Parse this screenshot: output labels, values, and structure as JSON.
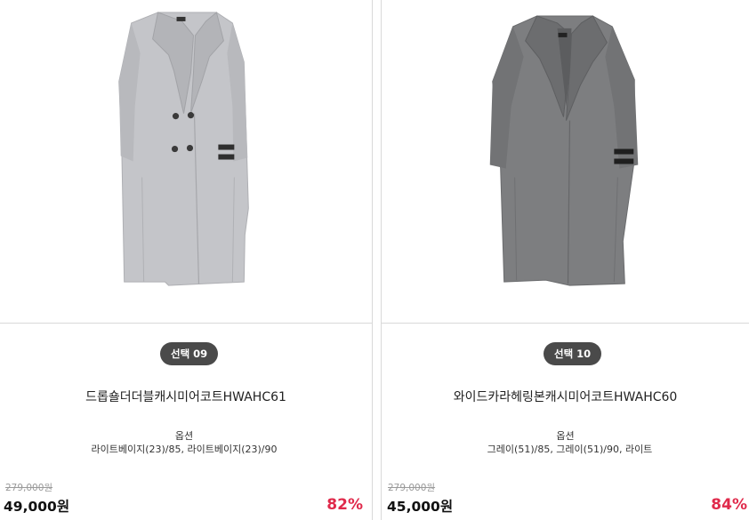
{
  "colors": {
    "badge_bg": "#4a4a4a",
    "discount": "#e02a4b",
    "original_price": "#9a9a9a",
    "divider": "#d9d9d9",
    "coat_light": "#c4c5c9",
    "coat_dark": "#7d7e80"
  },
  "products": [
    {
      "badge": "선택 09",
      "name": "드롭숄더더블캐시미어코트HWAHC61",
      "option_label": "옵션",
      "option_values": "라이트베이지(23)/85, 라이트베이지(23)/90",
      "original_price": "279,000원",
      "price": "49,000원",
      "discount": "82%",
      "image_alt": "light grey double-breasted long coat"
    },
    {
      "badge": "선택 10",
      "name": "와이드카라헤링본캐시미어코트HWAHC60",
      "option_label": "옵션",
      "option_values": "그레이(51)/85, 그레이(51)/90, 라이트",
      "original_price": "279,000원",
      "price": "45,000원",
      "discount": "84%",
      "image_alt": "charcoal grey wide-collar herringbone long coat"
    }
  ]
}
